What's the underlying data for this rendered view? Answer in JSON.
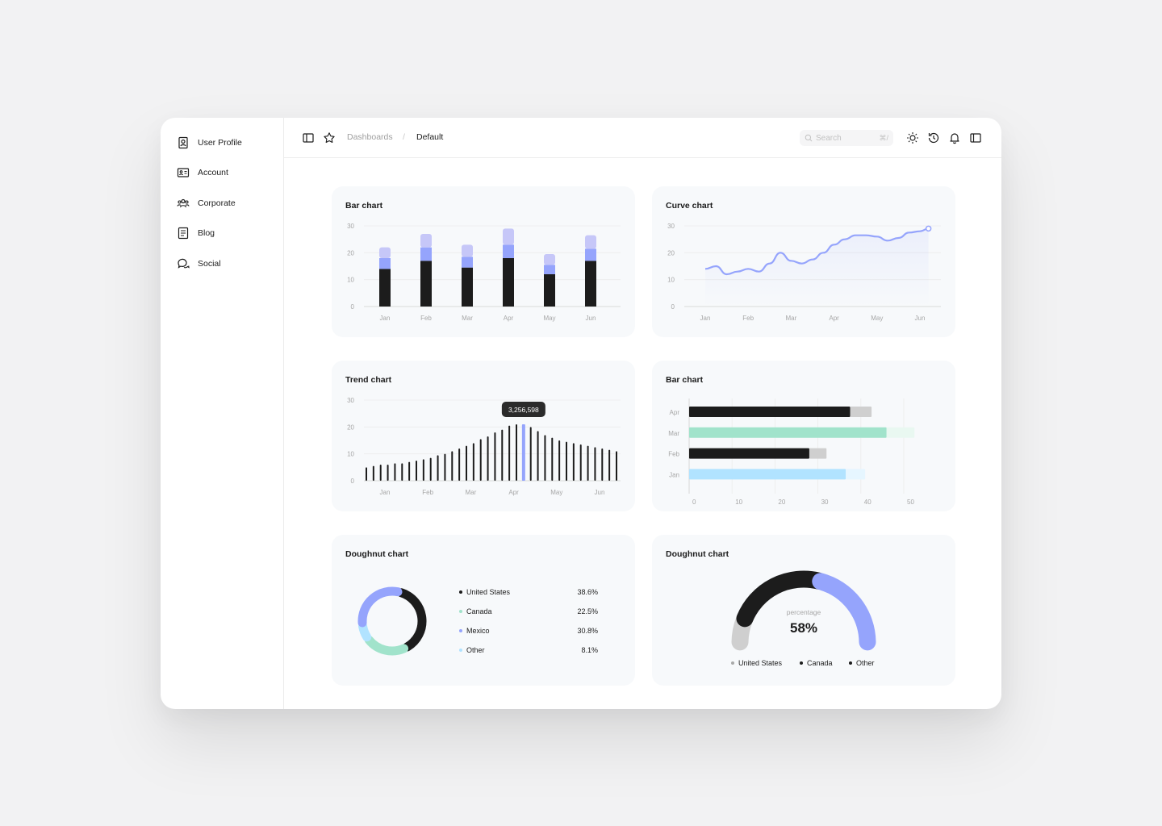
{
  "sidebar": {
    "items": [
      {
        "label": "User Profile",
        "icon": "user-profile-icon"
      },
      {
        "label": "Account",
        "icon": "id-card-icon"
      },
      {
        "label": "Corporate",
        "icon": "users-icon"
      },
      {
        "label": "Blog",
        "icon": "document-icon"
      },
      {
        "label": "Social",
        "icon": "chat-icon"
      }
    ]
  },
  "header": {
    "breadcrumb_root": "Dashboards",
    "breadcrumb_sep": "/",
    "breadcrumb_current": "Default",
    "search_placeholder": "Search",
    "search_shortcut": "⌘/"
  },
  "colors": {
    "dark": "#1c1c1c",
    "indigo": "#95a4fc",
    "lavender": "#c6c7f8",
    "mint": "#a1e3cb",
    "sky": "#b1e3ff",
    "gray": "#cfcfcf"
  },
  "chart_data": [
    {
      "type": "bar",
      "title": "Bar chart",
      "stacked": true,
      "categories": [
        "Jan",
        "Feb",
        "Mar",
        "Apr",
        "May",
        "Jun"
      ],
      "yticks": [
        0,
        10,
        20,
        30
      ],
      "ylim": [
        0,
        30
      ],
      "series": [
        {
          "values": [
            14,
            17,
            14.5,
            18,
            12,
            17
          ],
          "color": "#1c1c1c"
        },
        {
          "values": [
            4,
            5,
            4,
            5,
            3.5,
            4.5
          ],
          "color": "#95a4fc"
        },
        {
          "values": [
            4,
            5,
            4.5,
            6,
            4,
            5
          ],
          "color": "#c6c7f8"
        }
      ]
    },
    {
      "type": "line",
      "title": "Curve chart",
      "categories": [
        "Jan",
        "Feb",
        "Mar",
        "Apr",
        "May",
        "Jun"
      ],
      "yticks": [
        0,
        10,
        20,
        30
      ],
      "ylim": [
        0,
        30
      ],
      "x": [
        0,
        0.25,
        0.5,
        0.75,
        1,
        1.25,
        1.5,
        1.75,
        2,
        2.25,
        2.5,
        2.75,
        3,
        3.25,
        3.5,
        3.75,
        4,
        4.25,
        4.5,
        4.75,
        5,
        5.2
      ],
      "values": [
        14,
        15,
        12,
        13,
        14,
        13,
        16,
        20,
        17,
        16,
        17.5,
        20,
        23,
        25,
        26.5,
        26.5,
        26,
        24.5,
        25.5,
        27.5,
        28,
        29
      ],
      "color": "#95a4fc"
    },
    {
      "type": "bar",
      "title": "Trend chart",
      "categories": [
        "Jan",
        "Feb",
        "Mar",
        "Apr",
        "May",
        "Jun"
      ],
      "yticks": [
        0,
        10,
        20,
        30
      ],
      "ylim": [
        0,
        30
      ],
      "values": [
        5,
        5.5,
        6,
        6,
        6.5,
        6.5,
        7,
        7.5,
        8,
        8.5,
        9.5,
        10,
        11,
        12,
        13,
        14,
        15.5,
        16.5,
        18,
        19,
        20.5,
        21,
        21,
        20,
        18.5,
        17,
        16,
        15,
        14.5,
        14,
        13.5,
        13,
        12.5,
        12,
        11.5,
        11
      ],
      "highlight_index": 22,
      "highlight_color": "#95a4fc",
      "tooltip": "3,256,598"
    },
    {
      "type": "bar",
      "title": "Bar chart",
      "orientation": "horizontal",
      "categories": [
        "Apr",
        "Mar",
        "Feb",
        "Jan"
      ],
      "xticks": [
        0,
        10,
        20,
        30,
        40,
        50
      ],
      "xlim": [
        0,
        50
      ],
      "series": [
        {
          "values": [
            37.5,
            46,
            28,
            36.5
          ],
          "colors": [
            "#1c1c1c",
            "#a1e3cb",
            "#1c1c1c",
            "#b1e3ff"
          ]
        },
        {
          "values": [
            5,
            6.5,
            4,
            4.5
          ],
          "colors": [
            "#cfcfcf",
            "#e9f8f1",
            "#cfcfcf",
            "#e6f6ff"
          ]
        }
      ]
    },
    {
      "type": "pie",
      "title": "Doughnut chart",
      "labels": [
        "United States",
        "Canada",
        "Mexico",
        "Other"
      ],
      "values": [
        38.6,
        22.5,
        30.8,
        8.1
      ],
      "display": [
        "38.6%",
        "22.5%",
        "30.8%",
        "8.1%"
      ],
      "colors": [
        "#1c1c1c",
        "#a1e3cb",
        "#95a4fc",
        "#b1e3ff"
      ]
    },
    {
      "type": "pie",
      "title": "Doughnut chart",
      "half": true,
      "center_label": "percentage",
      "center_value": "58%",
      "labels": [
        "United States",
        "Canada",
        "Other"
      ],
      "values": [
        12,
        46,
        42
      ],
      "colors": [
        "#cfcfcf",
        "#1c1c1c",
        "#95a4fc"
      ]
    }
  ]
}
